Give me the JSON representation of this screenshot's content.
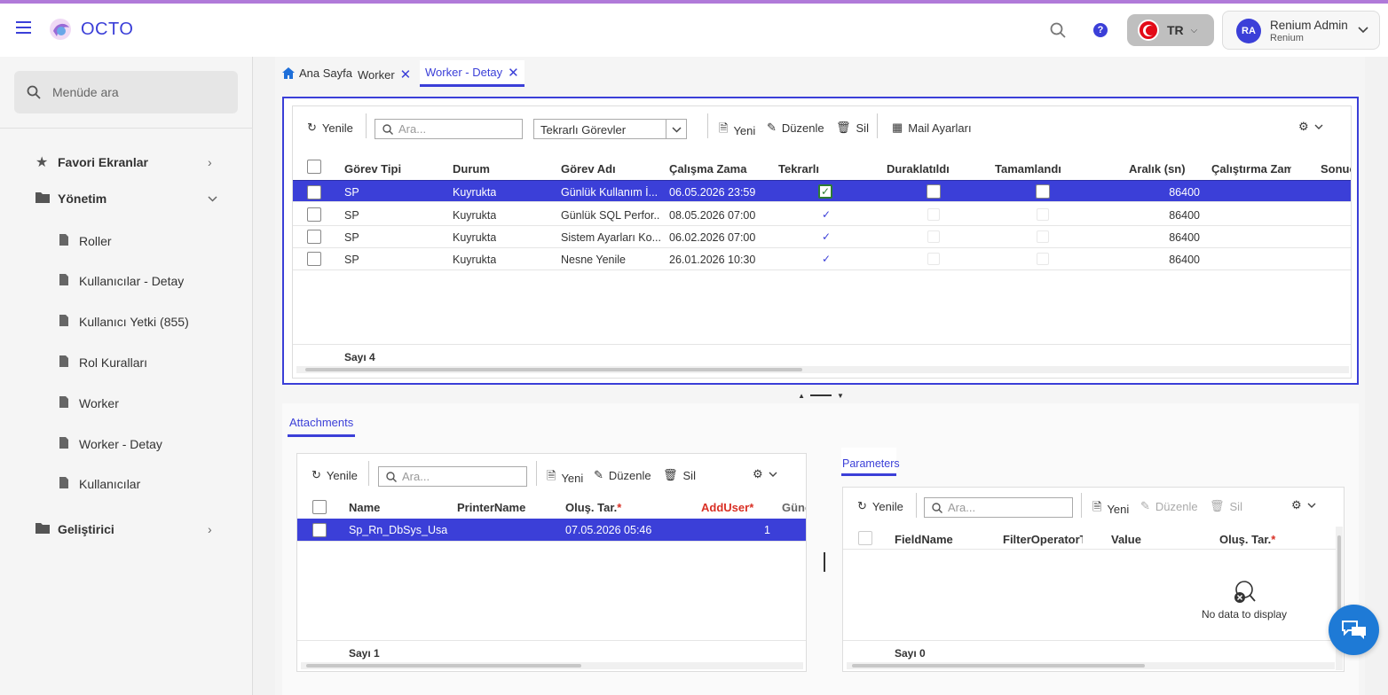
{
  "app": {
    "brand": "OCTO"
  },
  "topbar": {
    "lang_code": "TR",
    "user_initials": "RA",
    "user_name": "Renium Admin",
    "user_org": "Renium"
  },
  "sidebar": {
    "search_placeholder": "Menüde ara",
    "items": [
      {
        "label": "Favori Ekranlar",
        "icon": "star-icon"
      },
      {
        "label": "Yönetim",
        "icon": "folder-icon"
      },
      {
        "label": "Roller",
        "icon": "file-icon"
      },
      {
        "label": "Kullanıcılar - Detay",
        "icon": "file-icon"
      },
      {
        "label": "Kullanıcı Yetki (855)",
        "icon": "file-icon"
      },
      {
        "label": "Rol Kuralları",
        "icon": "file-icon"
      },
      {
        "label": "Worker",
        "icon": "file-icon"
      },
      {
        "label": "Worker - Detay",
        "icon": "file-icon"
      },
      {
        "label": "Kullanıcılar",
        "icon": "file-icon"
      },
      {
        "label": "Geliştirici",
        "icon": "folder-icon"
      }
    ]
  },
  "tabs": [
    {
      "label": "Ana Sayfa"
    },
    {
      "label": "Worker"
    },
    {
      "label": "Worker - Detay"
    }
  ],
  "grid1": {
    "toolbar": {
      "refresh": "Yenile",
      "search_placeholder": "Ara...",
      "filter_value": "Tekrarlı Görevler",
      "new": "Yeni",
      "edit": "Düzenle",
      "delete": "Sil",
      "mail": "Mail Ayarları"
    },
    "columns": [
      "Görev Tipi",
      "Durum",
      "Görev Adı",
      "Çalışma Zamanı",
      "Tekrarlı",
      "Duraklatıldı",
      "Tamamlandı",
      "Aralık (sn)",
      "Çalıştırma Zamanı",
      "Sonuç"
    ],
    "rows": [
      {
        "tip": "SP",
        "durum": "Kuyrukta",
        "ad": "Günlük Kullanım İ...",
        "zaman": "06.05.2026 23:59",
        "aralik": "86400"
      },
      {
        "tip": "SP",
        "durum": "Kuyrukta",
        "ad": "Günlük SQL Perfor...",
        "zaman": "08.05.2026 07:00",
        "aralik": "86400"
      },
      {
        "tip": "SP",
        "durum": "Kuyrukta",
        "ad": "Sistem Ayarları Ko...",
        "zaman": "06.02.2026 07:00",
        "aralik": "86400"
      },
      {
        "tip": "SP",
        "durum": "Kuyrukta",
        "ad": "Nesne Yenile",
        "zaman": "26.01.2026 10:30",
        "aralik": "86400"
      }
    ],
    "count": "Sayı 4"
  },
  "attachments": {
    "tab": "Attachments",
    "toolbar": {
      "refresh": "Yenile",
      "search_placeholder": "Ara...",
      "new": "Yeni",
      "edit": "Düzenle",
      "delete": "Sil"
    },
    "columns": [
      "Name",
      "PrinterName",
      "Oluş. Tar.",
      "AddUser",
      "Günc"
    ],
    "rows": [
      {
        "name": "Sp_Rn_DbSys_Usa...",
        "printer": "",
        "date": "07.05.2026 05:46",
        "adduser": "1"
      }
    ],
    "count": "Sayı 1"
  },
  "parameters": {
    "tab": "Parameters",
    "toolbar": {
      "refresh": "Yenile",
      "search_placeholder": "Ara...",
      "new": "Yeni",
      "edit": "Düzenle",
      "delete": "Sil"
    },
    "columns": [
      "FieldName",
      "FilterOperatorT",
      "Value",
      "Oluş. Tar."
    ],
    "empty": "No data to display",
    "count": "Sayı 0"
  }
}
